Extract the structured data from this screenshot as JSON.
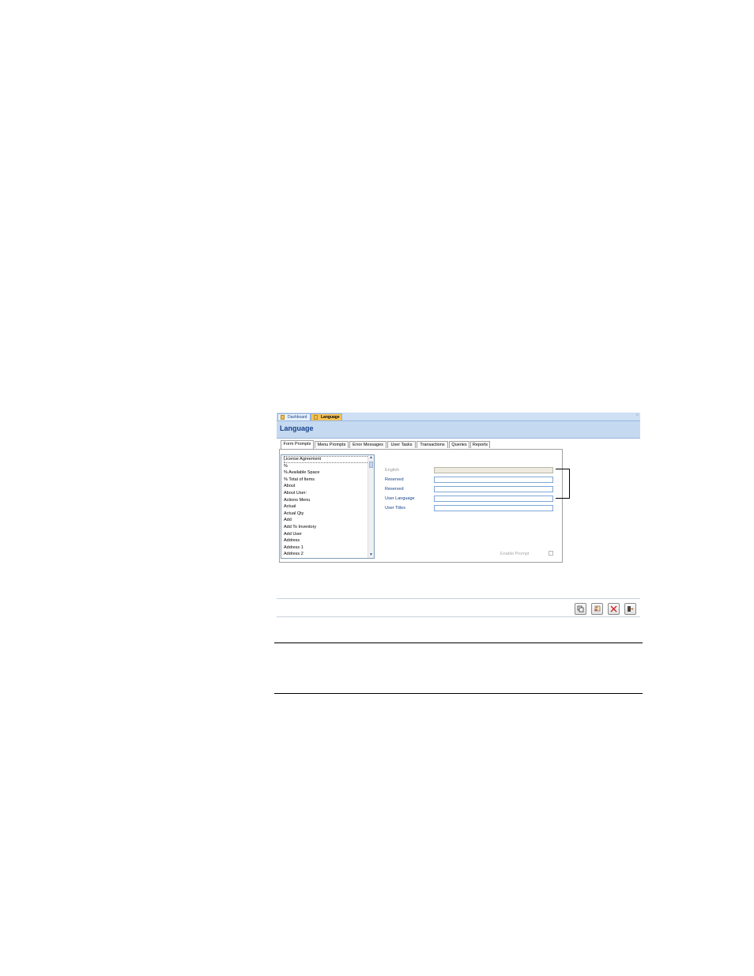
{
  "doc_tabs": [
    {
      "label": "Dashboard"
    },
    {
      "label": "Language"
    }
  ],
  "form": {
    "title": "Language",
    "tabs": [
      "Form Prompts",
      "Menu Prompts",
      "Error Messages",
      "User Tasks",
      "Transactions",
      "Queries",
      "Reports"
    ],
    "list_items": [
      "License Agreement",
      "%",
      "% Available Space",
      "% Total of Items",
      "About",
      "About User:",
      "Actions Menu",
      "Actual",
      "Actual Qty",
      "Add",
      "Add To Inventory",
      "Add User",
      "Address",
      "Address 1",
      "Address 2"
    ],
    "fields": {
      "english": "English",
      "reserved_1": "Reserved",
      "reserved_2": "Reserved",
      "user_language": "User Language",
      "user_titles": "User Titles"
    },
    "enable_prompt": "Enable Prompt"
  },
  "toolbar_icons": [
    "copy-icon",
    "undo-icon",
    "delete-icon",
    "exit-icon"
  ]
}
